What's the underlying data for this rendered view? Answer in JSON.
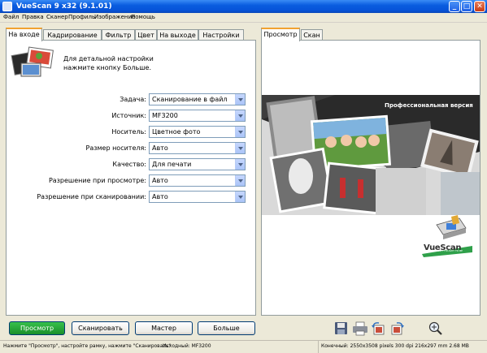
{
  "window": {
    "title": "VueScan 9 x32 (9.1.01)",
    "minimize": "_",
    "maximize": "□",
    "close": "✕"
  },
  "menu": [
    "Файл",
    "Правка",
    "Сканер",
    "Профиль",
    "Изображение",
    "Помощь"
  ],
  "left_tabs": [
    "На входе",
    "Кадрирование",
    "Фильтр",
    "Цвет",
    "На выходе",
    "Настройки"
  ],
  "right_tabs": [
    "Просмотр",
    "Скан"
  ],
  "hint": {
    "line1": "Для детальной настройки",
    "line2": "нажмите кнопку Больше."
  },
  "fields": [
    {
      "label": "Задача:",
      "value": "Сканирование в файл"
    },
    {
      "label": "Источник:",
      "value": "MF3200"
    },
    {
      "label": "Носитель:",
      "value": "Цветное фото"
    },
    {
      "label": "Размер носителя:",
      "value": "Авто"
    },
    {
      "label": "Качество:",
      "value": "Для печати"
    },
    {
      "label": "Разрешение при просмотре:",
      "value": "Авто"
    },
    {
      "label": "Разрешение при сканировании:",
      "value": "Авто"
    }
  ],
  "preview": {
    "banner": "Профессиональная версия",
    "logo": "VueScan",
    "logo_tagline": "THE WAY IT OUGHT TO BE"
  },
  "buttons": {
    "preview": "Просмотр",
    "scan": "Сканировать",
    "wizard": "Мастер",
    "more": "Больше"
  },
  "toolbar_icons": [
    "save-icon",
    "print-icon",
    "rotate-left-icon",
    "rotate-right-icon",
    "zoom-icon"
  ],
  "status": {
    "hint": "Нажмите \"Просмотр\", настройте рамку, нажмите \"Сканировать\"",
    "device": "Исходный: MF3200",
    "output": "Конечный: 2550x3508 pixels 300 dpi 216x297 mm 2.68 MB"
  }
}
